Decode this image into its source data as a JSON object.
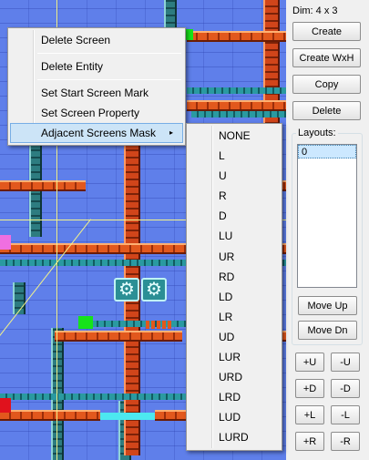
{
  "context_menu": {
    "items": [
      {
        "label": "Delete Screen"
      },
      {
        "label": "Delete Entity"
      },
      {
        "label": "Set Start Screen Mark"
      },
      {
        "label": "Set Screen Property"
      },
      {
        "label": "Adjacent Screens Mask",
        "has_submenu": true,
        "highlighted": true
      }
    ],
    "submenu_items": [
      "NONE",
      "L",
      "U",
      "R",
      "D",
      "LU",
      "UR",
      "RD",
      "LD",
      "LR",
      "UD",
      "LUR",
      "URD",
      "LRD",
      "LUD",
      "LURD"
    ],
    "arrow_icon": "▸"
  },
  "panel": {
    "dim_label": "Dim: 4 x 3",
    "buttons": {
      "create": "Create",
      "create_wxh": "Create WxH",
      "copy": "Copy",
      "delete": "Delete"
    },
    "layouts": {
      "title": "Layouts:",
      "items": [
        "0"
      ],
      "move_up": "Move Up",
      "move_down": "Move Dn"
    },
    "shift_buttons": {
      "up_plus": "+U",
      "up_minus": "-U",
      "down_plus": "+D",
      "down_minus": "-D",
      "left_plus": "+L",
      "left_minus": "-L",
      "right_plus": "+R",
      "right_minus": "-R"
    }
  },
  "canvas": {
    "fan_icon": "⚙",
    "colors": {
      "background": "#5f7fea",
      "girder": "#e2581d",
      "pipe": "#2d7c80",
      "green_marker": "#16e31a",
      "pink_marker": "#f06fe1",
      "red_marker": "#e0121d",
      "cyan_bar": "#4ce8f0",
      "menu_highlight": "#cce4f7"
    }
  }
}
